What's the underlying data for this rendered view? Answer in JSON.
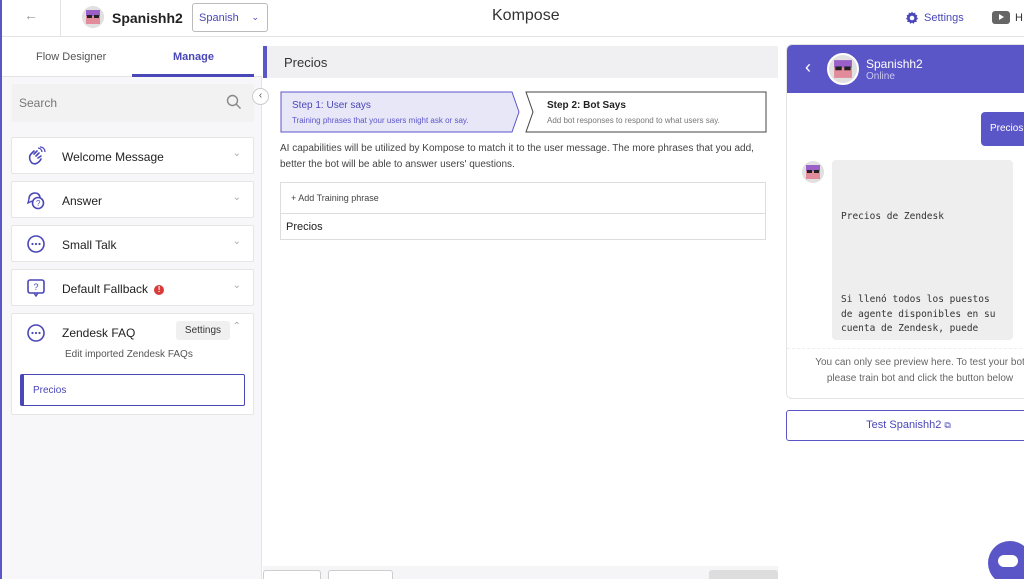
{
  "header": {
    "bot_name": "Spanishh2",
    "language": "Spanish",
    "title": "Kompose",
    "settings_label": "Settings",
    "help_label": "H"
  },
  "sidebar": {
    "tabs": [
      {
        "label": "Flow Designer"
      },
      {
        "label": "Manage"
      }
    ],
    "search_placeholder": "Search",
    "items": [
      {
        "label": "Welcome Message",
        "icon": "waving-hand-icon"
      },
      {
        "label": "Answer",
        "icon": "question-bubble-icon"
      },
      {
        "label": "Small Talk",
        "icon": "chat-dots-icon"
      },
      {
        "label": "Default Fallback",
        "icon": "question-box-icon",
        "alert": "!"
      },
      {
        "label": "Zendesk FAQ",
        "icon": "chat-dots-icon",
        "action": "Settings",
        "subtitle": "Edit imported Zendesk FAQs",
        "selected_child": "Precios"
      }
    ]
  },
  "main": {
    "title": "Precios",
    "step1": {
      "title": "Step 1: User says",
      "subtitle": "Training phrases that your users might ask or say."
    },
    "step2": {
      "title": "Step 2: Bot Says",
      "subtitle": "Add bot responses to respond to what users say."
    },
    "help_text": "AI capabilities will be utilized by Kompose to match it to the user message. The more phrases that you add, better the bot will be able to answer users' questions.",
    "add_phrase_label": "+ Add Training phrase",
    "phrases": [
      "Precios"
    ]
  },
  "preview": {
    "bot_name": "Spanishh2",
    "status": "Online",
    "user_message": "Precios",
    "bot_line1": "Precios de Zendesk",
    "bot_line2": "Si llenó todos los puestos de agente disponibles en su cuenta de Zendesk, puede",
    "note_line1": "You can only see preview here. To test your bot",
    "note_line2": "please train bot and click the button below",
    "test_button": "Test Spanishh2"
  },
  "colors": {
    "accent": "#5b56c8",
    "alert": "#d93a3a"
  }
}
